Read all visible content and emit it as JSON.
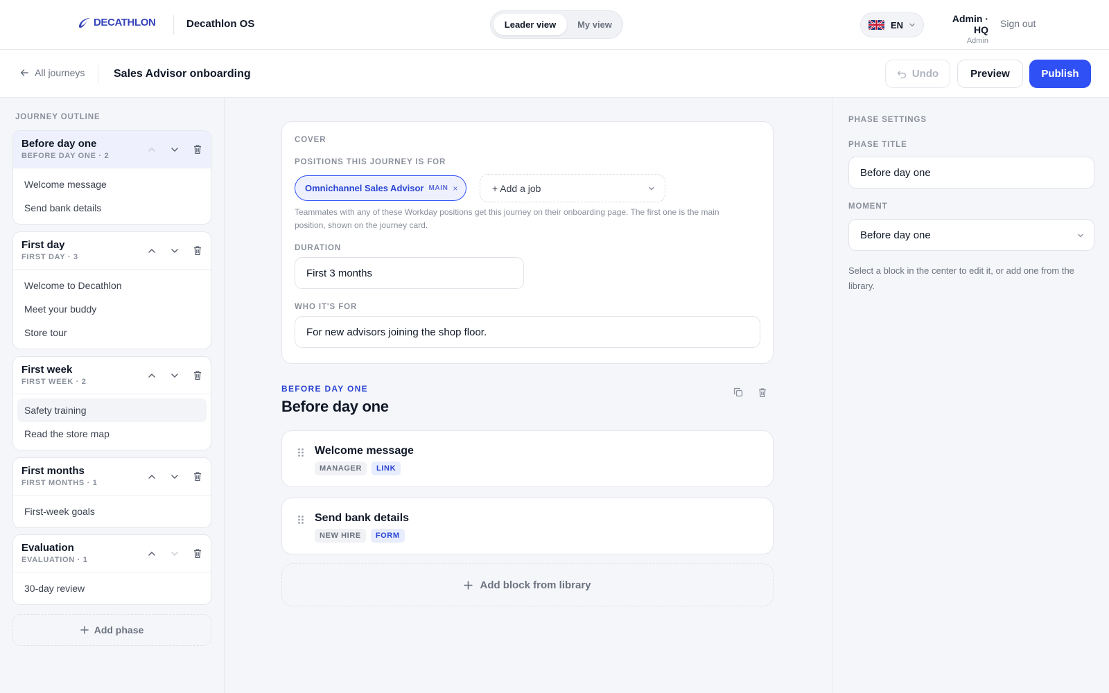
{
  "header": {
    "brand": "DECATHLON",
    "app_name": "Decathlon OS",
    "view_toggle": {
      "active": "Leader view",
      "inactive": "My view"
    },
    "language": "EN",
    "user": {
      "name": "Admin · HQ",
      "role": "Admin"
    },
    "sign_out": "Sign out"
  },
  "toolbar": {
    "back_label": "All journeys",
    "journey_title": "Sales Advisor onboarding",
    "undo_label": "Undo",
    "preview_label": "Preview",
    "publish_label": "Publish"
  },
  "outline": {
    "title": "JOURNEY OUTLINE",
    "phases": [
      {
        "name": "Before day one",
        "sub": "BEFORE DAY ONE · 2",
        "items": [
          "Welcome message",
          "Send bank details"
        ]
      },
      {
        "name": "First day",
        "sub": "FIRST DAY · 3",
        "items": [
          "Welcome to Decathlon",
          "Meet your buddy",
          "Store tour"
        ]
      },
      {
        "name": "First week",
        "sub": "FIRST WEEK · 2",
        "items": [
          "Safety training",
          "Read the store map"
        ]
      },
      {
        "name": "First months",
        "sub": "FIRST MONTHS · 1",
        "items": [
          "First-week goals"
        ]
      },
      {
        "name": "Evaluation",
        "sub": "EVALUATION · 1",
        "items": [
          "30-day review"
        ]
      }
    ],
    "add_phase": "Add phase"
  },
  "cover": {
    "title": "COVER",
    "positions_label": "POSITIONS THIS JOURNEY IS FOR",
    "main_position": "Omnichannel Sales Advisor",
    "main_tag": "MAIN",
    "remove_glyph": "×",
    "add_job": "+ Add a job",
    "help": "Teammates with any of these Workday positions get this journey on their onboarding page. The first one is the main position, shown on the journey card.",
    "duration_label": "DURATION",
    "duration_value": "First 3 months",
    "who_label": "WHO IT'S FOR",
    "who_value": "For new advisors joining the shop floor."
  },
  "phase": {
    "kicker": "BEFORE DAY ONE",
    "title": "Before day one",
    "blocks": [
      {
        "title": "Welcome message",
        "tags": [
          "MANAGER",
          "LINK"
        ]
      },
      {
        "title": "Send bank details",
        "tags": [
          "NEW HIRE",
          "FORM"
        ]
      }
    ],
    "add_block": "Add block from library"
  },
  "settings": {
    "title": "PHASE SETTINGS",
    "phase_title_label": "PHASE TITLE",
    "phase_title_value": "Before day one",
    "moment_label": "MOMENT",
    "moment_value": "Before day one",
    "help": "Select a block in the center to edit it, or add one from the library."
  },
  "colors": {
    "accent": "#2f50f5",
    "brand": "#3643ba",
    "active_phase_bg": "#eef1fd"
  }
}
